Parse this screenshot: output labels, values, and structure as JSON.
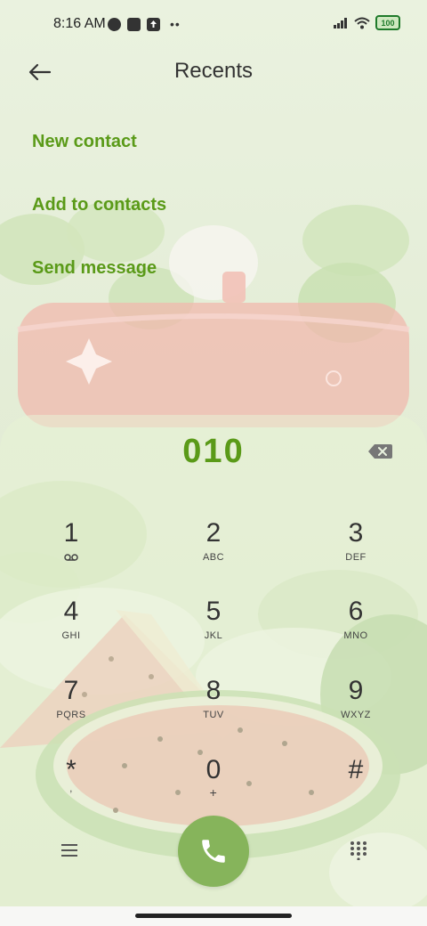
{
  "status_bar": {
    "time": "8:16 AM",
    "battery": "100",
    "left_icons": [
      "data-saver-icon",
      "app-notification-icon",
      "upload-icon",
      "more-dots-icon"
    ],
    "right_icons": [
      "signal-icon",
      "wifi-icon",
      "battery-icon"
    ]
  },
  "header": {
    "title": "Recents",
    "back_icon": "arrow-left-icon"
  },
  "actions": [
    {
      "label": "New contact"
    },
    {
      "label": "Add to contacts"
    },
    {
      "label": "Send message"
    }
  ],
  "dialer": {
    "number": "010",
    "keys": [
      {
        "digit": "1",
        "letters": ""
      },
      {
        "digit": "2",
        "letters": "ABC"
      },
      {
        "digit": "3",
        "letters": "DEF"
      },
      {
        "digit": "4",
        "letters": "GHI"
      },
      {
        "digit": "5",
        "letters": "JKL"
      },
      {
        "digit": "6",
        "letters": "MNO"
      },
      {
        "digit": "7",
        "letters": "PQRS"
      },
      {
        "digit": "8",
        "letters": "TUV"
      },
      {
        "digit": "9",
        "letters": "WXYZ"
      },
      {
        "digit": "*",
        "letters": ","
      },
      {
        "digit": "0",
        "letters": "+"
      },
      {
        "digit": "#",
        "letters": ""
      }
    ]
  },
  "colors": {
    "accent": "#5a9a18",
    "call_button": "#86b45b",
    "background": "#e6efda"
  }
}
